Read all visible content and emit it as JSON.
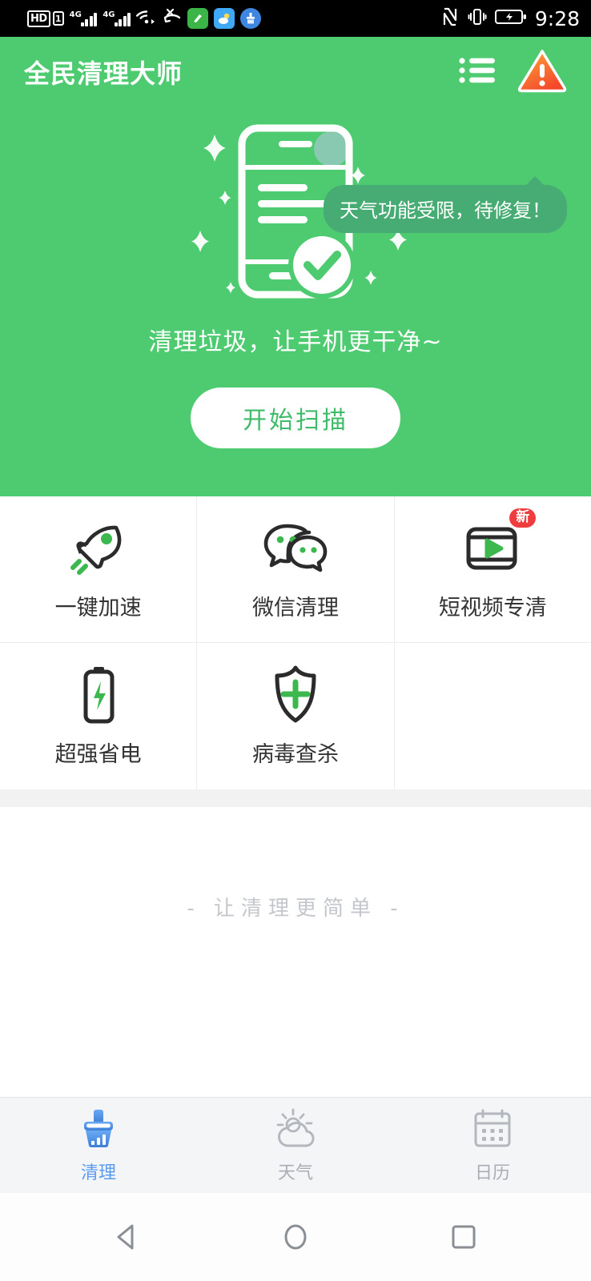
{
  "status_bar": {
    "hd_label": "HD",
    "sim_label": "1",
    "network_1": "4G",
    "network_2": "4G",
    "icons": [
      "hd-icon",
      "sim1-icon",
      "signal-4g-icon",
      "signal-4g-icon",
      "wifi-icon",
      "missed-call-icon",
      "green-brush-app-icon",
      "weather-app-icon",
      "cleaner-app-icon",
      "nfc-icon",
      "vibrate-icon",
      "battery-charging-icon"
    ],
    "time": "9:28"
  },
  "app_bar": {
    "title": "全民清理大师",
    "menu_icon": "list-menu-icon",
    "warning_icon": "warning-triangle-icon"
  },
  "hero": {
    "tooltip": "天气功能受限，待修复！",
    "subtitle": "清理垃圾，让手机更干净~",
    "scan_button": "开始扫描",
    "bg_color": "#4ecb71",
    "tooltip_bg": "#47ac73",
    "button_text_color": "#3fbb6a"
  },
  "features": {
    "row1": [
      {
        "label": "一键加速",
        "icon": "rocket-icon",
        "badge": null
      },
      {
        "label": "微信清理",
        "icon": "wechat-icon",
        "badge": null
      },
      {
        "label": "短视频专清",
        "icon": "video-player-icon",
        "badge": "新"
      }
    ],
    "row2": [
      {
        "label": "超强省电",
        "icon": "battery-icon",
        "badge": null
      },
      {
        "label": "病毒查杀",
        "icon": "shield-plus-icon",
        "badge": null
      },
      {
        "label": "",
        "icon": null,
        "badge": null
      }
    ]
  },
  "slogan": "- 让清理更简单 -",
  "tabs": [
    {
      "label": "清理",
      "icon": "broom-icon",
      "active": true,
      "color": "#5b9bf0"
    },
    {
      "label": "天气",
      "icon": "sun-cloud-icon",
      "active": false,
      "color": "#a9adb3"
    },
    {
      "label": "日历",
      "icon": "calendar-icon",
      "active": false,
      "color": "#a9adb3"
    }
  ],
  "nav_bar": {
    "back": "back-triangle-icon",
    "home": "home-circle-icon",
    "recents": "recents-square-icon"
  }
}
